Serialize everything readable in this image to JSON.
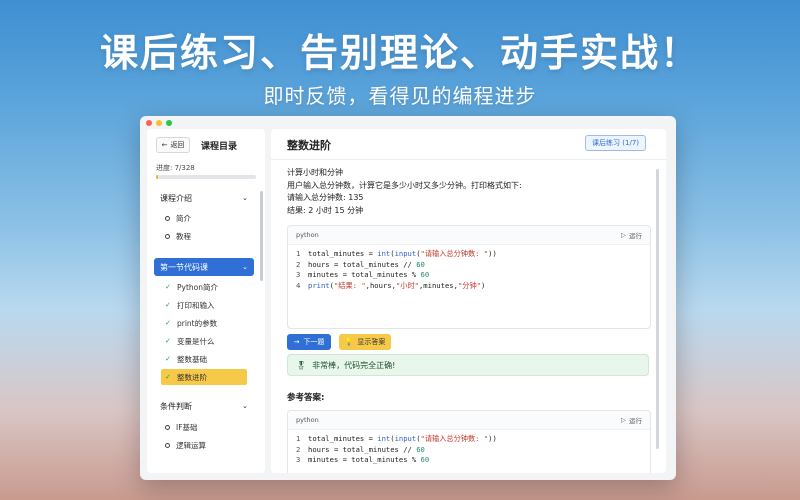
{
  "hero": {
    "headline": "课后练习、告别理论、动手实战！",
    "subline": "即时反馈，看得见的编程进步"
  },
  "window": {
    "controls": [
      "close",
      "minimize",
      "zoom"
    ],
    "colors": {
      "close": "#ff5f57",
      "minimize": "#febc2e",
      "zoom": "#28c840",
      "accent": "#2f6fd6",
      "highlight": "#f7c948"
    }
  },
  "sidebar": {
    "back_label": "返回",
    "title": "课程目录",
    "progress_label": "进度: 7/328",
    "progress_value": 0.021,
    "sections": [
      {
        "label": "课程介绍",
        "expanded": true,
        "items": [
          {
            "label": "简介",
            "status": "todo"
          },
          {
            "label": "教程",
            "status": "todo"
          }
        ]
      },
      {
        "label": "第一节代码课",
        "expanded": true,
        "active": true,
        "items": [
          {
            "label": "Python简介",
            "status": "done"
          },
          {
            "label": "打印和输入",
            "status": "done"
          },
          {
            "label": "print的参数",
            "status": "done"
          },
          {
            "label": "变量是什么",
            "status": "done"
          },
          {
            "label": "整数基础",
            "status": "done"
          },
          {
            "label": "整数进阶",
            "status": "done",
            "current": true
          }
        ]
      },
      {
        "label": "条件判断",
        "expanded": true,
        "items": [
          {
            "label": "IF基础",
            "status": "todo"
          },
          {
            "label": "逻辑运算",
            "status": "todo"
          }
        ]
      }
    ]
  },
  "main": {
    "title": "整数进阶",
    "exercise_button": "课后练习 (1/7)",
    "description": [
      "计算小时和分钟",
      "用户输入总分钟数，计算它是多少小时又多少分钟。打印格式如下:",
      "请输入总分钟数: 135",
      "结果:  2 小时 15 分钟"
    ],
    "editor": {
      "language": "python",
      "run_label": "运行",
      "lines": [
        {
          "n": "1",
          "parts": [
            {
              "t": "total_minutes = ",
              "c": ""
            },
            {
              "t": "int",
              "c": "kw"
            },
            {
              "t": "(",
              "c": ""
            },
            {
              "t": "input",
              "c": "kw"
            },
            {
              "t": "(",
              "c": ""
            },
            {
              "t": "\"请输入总分钟数: \"",
              "c": "str"
            },
            {
              "t": "))",
              "c": ""
            }
          ]
        },
        {
          "n": "2",
          "parts": [
            {
              "t": "hours = total_minutes // ",
              "c": ""
            },
            {
              "t": "60",
              "c": "num"
            }
          ]
        },
        {
          "n": "3",
          "parts": [
            {
              "t": "minutes = total_minutes % ",
              "c": ""
            },
            {
              "t": "60",
              "c": "num"
            }
          ]
        },
        {
          "n": "4",
          "parts": [
            {
              "t": "print",
              "c": "kw"
            },
            {
              "t": "(",
              "c": ""
            },
            {
              "t": "\"结果: \"",
              "c": "str"
            },
            {
              "t": ",hours,",
              "c": ""
            },
            {
              "t": "\"小时\"",
              "c": "str"
            },
            {
              "t": ",minutes,",
              "c": ""
            },
            {
              "t": "\"分钟\"",
              "c": "str"
            },
            {
              "t": ")",
              "c": ""
            }
          ]
        }
      ]
    },
    "next_button": "下一题",
    "show_answer_button": "显示答案",
    "success_message": "非常棒，代码完全正确!",
    "reference_title": "参考答案:",
    "answer": {
      "language": "python",
      "run_label": "运行",
      "lines": [
        {
          "n": "1",
          "parts": [
            {
              "t": "total_minutes = ",
              "c": ""
            },
            {
              "t": "int",
              "c": "kw"
            },
            {
              "t": "(",
              "c": ""
            },
            {
              "t": "input",
              "c": "kw"
            },
            {
              "t": "(",
              "c": ""
            },
            {
              "t": "\"请输入总分钟数: \"",
              "c": "str"
            },
            {
              "t": "))",
              "c": ""
            }
          ]
        },
        {
          "n": "2",
          "parts": [
            {
              "t": "hours = total_minutes // ",
              "c": ""
            },
            {
              "t": "60",
              "c": "num"
            }
          ]
        },
        {
          "n": "3",
          "parts": [
            {
              "t": "minutes = total_minutes % ",
              "c": ""
            },
            {
              "t": "60",
              "c": "num"
            }
          ]
        }
      ]
    }
  }
}
